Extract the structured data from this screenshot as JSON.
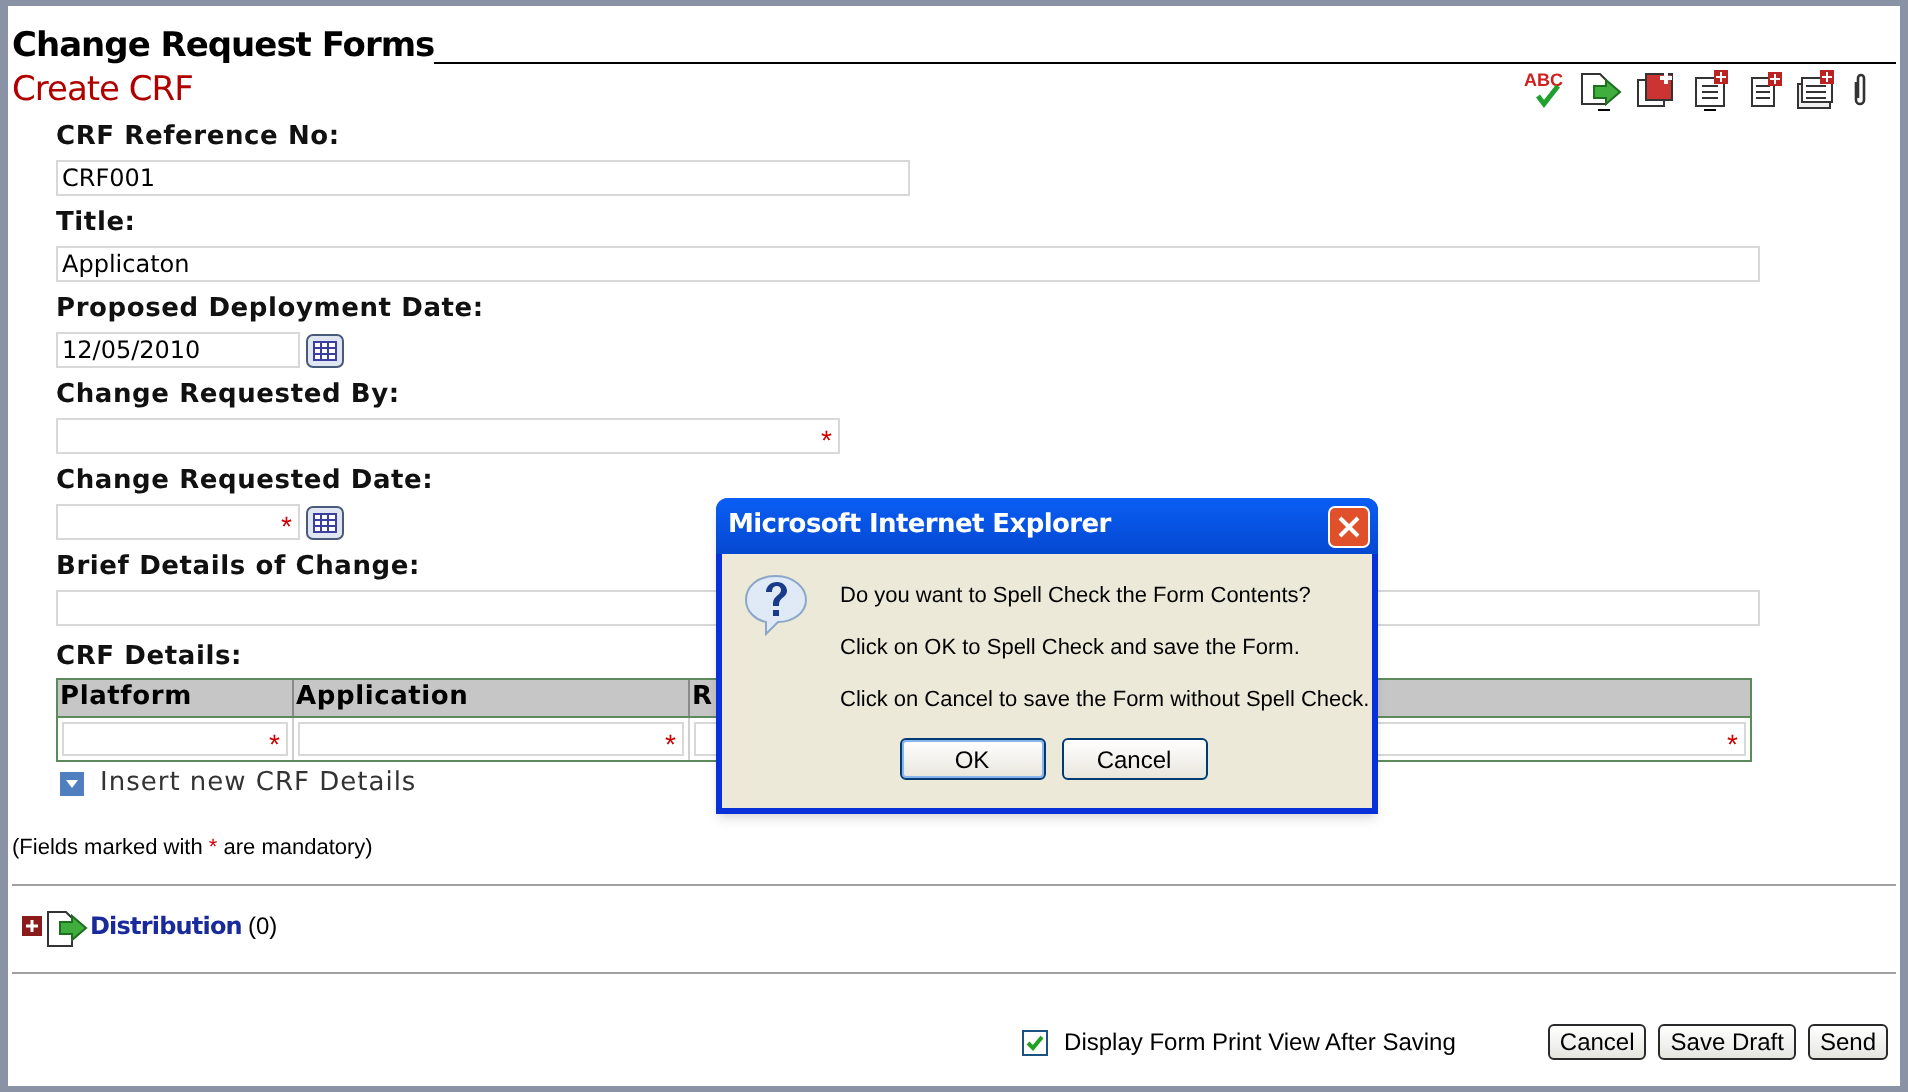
{
  "page_title": "Change Request Forms",
  "form_title": "Create CRF",
  "toolbar": {
    "spell_check_letters": "ABC",
    "icons": [
      {
        "kind": "spellcheck"
      },
      {
        "kind": "forward"
      },
      {
        "kind": "copy"
      },
      {
        "kind": "addlist"
      },
      {
        "kind": "addpage"
      },
      {
        "kind": "addstack"
      },
      {
        "kind": "attach"
      }
    ]
  },
  "fields": [
    {
      "label": "CRF Reference No:",
      "value": "CRF001",
      "kind": "text"
    },
    {
      "label": "Title:",
      "value": "Applicaton",
      "kind": "text"
    },
    {
      "label": "Proposed Deployment Date:",
      "value": "12/05/2010",
      "kind": "date"
    },
    {
      "label": "Change Requested By:",
      "kind": "text",
      "marker": "*"
    },
    {
      "label": "Change Requested Date:",
      "kind": "date",
      "marker": "*"
    },
    {
      "label": "Brief Details of Change:",
      "kind": "text"
    }
  ],
  "details": {
    "label": "CRF Details:",
    "columns": [
      "Platform",
      "Application",
      "R"
    ],
    "row_markers": [
      "*",
      "*",
      "*"
    ],
    "insert_link": "Insert new CRF Details"
  },
  "mandatory_note": {
    "before": "(Fields marked with ",
    "mark": "*",
    "after": " are mandatory)"
  },
  "distribution": {
    "label": "Distribution",
    "count": "(0)",
    "expanded": false
  },
  "footer": {
    "print_view_label": "Display Form Print View After Saving",
    "print_view_checked": true,
    "buttons": [
      "Cancel",
      "Save Draft",
      "Send"
    ]
  },
  "dialog": {
    "title": "Microsoft Internet Explorer",
    "lines": [
      "Do you want to Spell Check the Form Contents?",
      "Click on OK to Spell Check and save the Form.",
      "Click on Cancel to save the Form without Spell Check."
    ],
    "buttons": [
      "OK",
      "Cancel"
    ]
  }
}
